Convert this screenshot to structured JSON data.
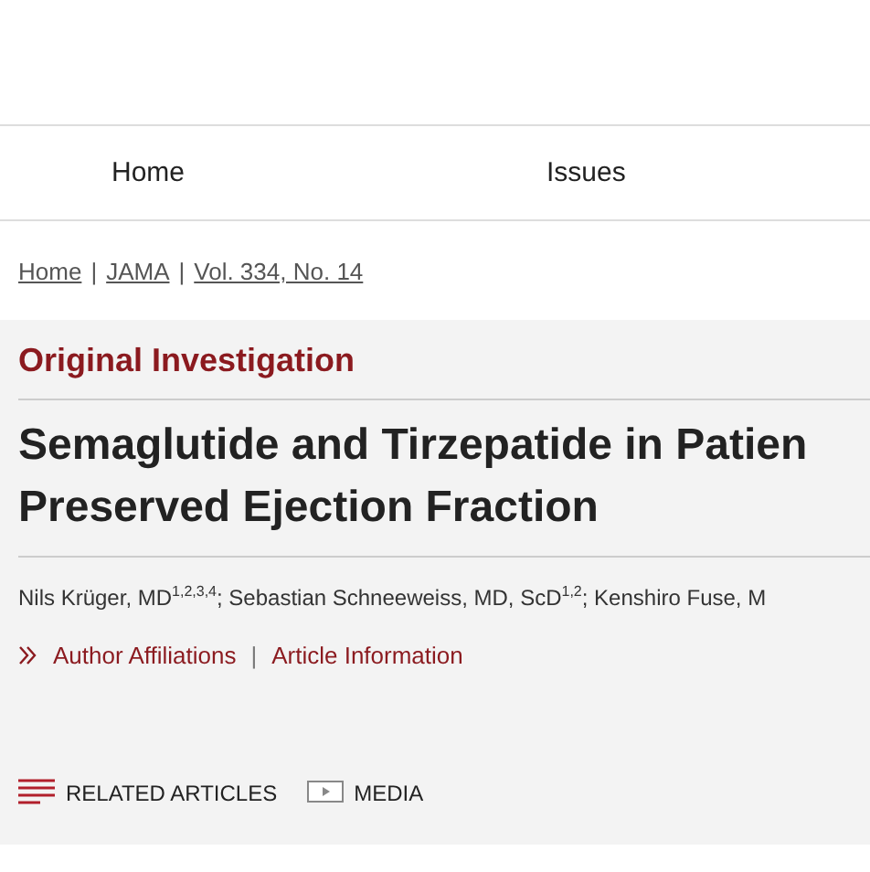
{
  "nav": {
    "items": [
      "Home",
      "Issues"
    ]
  },
  "breadcrumb": [
    {
      "kind": "link",
      "text": "Home"
    },
    {
      "kind": "separator",
      "text": "|"
    },
    {
      "kind": "link",
      "text": "JAMA"
    },
    {
      "kind": "separator",
      "text": "|"
    },
    {
      "kind": "link",
      "text": "Vol. 334, No. 14"
    }
  ],
  "article": {
    "type": "Original Investigation",
    "title_lines": [
      "Semaglutide and Tirzepatide in Patien",
      "Preserved Ejection Fraction"
    ],
    "authors": "Nils Krüger, MD$^{1,2,3,4}$; Sebastian Schneeweiss, MD, ScD$^{1,2}$; Kenshiro Fuse, M",
    "info_links": [
      {
        "kind": "link",
        "text": "Author Affiliations"
      },
      {
        "kind": "separator",
        "text": "|"
      },
      {
        "kind": "link",
        "text": "Article Information"
      }
    ],
    "tools": [
      {
        "kind": "related",
        "label": "RELATED ARTICLES"
      },
      {
        "kind": "media",
        "label": "MEDIA"
      }
    ]
  }
}
